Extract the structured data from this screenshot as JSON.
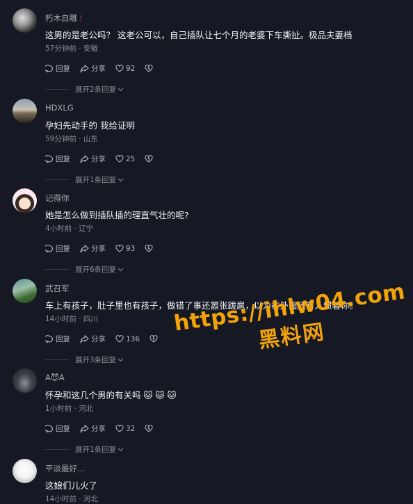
{
  "comments": [
    {
      "name": "朽木自雕",
      "name_suffix": "🕯",
      "text": "这男的是老公吗？ 这老公可以，自己插队让七个月的老婆下车撕扯。极品夫妻档",
      "meta": "57分钟前 · 安徽",
      "reply": "回复",
      "share": "分享",
      "likes": "92",
      "expand": "展开2条回复"
    },
    {
      "name": "HDXLG",
      "name_suffix": "",
      "text": "孕妇先动手的 我给证明",
      "meta": "59分钟前 · 山东",
      "reply": "回复",
      "share": "分享",
      "likes": "25",
      "expand": "展开1条回复"
    },
    {
      "name": "记得你",
      "name_suffix": "",
      "text": "她是怎么做到插队插的理直气壮的呢?",
      "meta": "4小时前 · 辽宁",
      "reply": "回复",
      "share": "分享",
      "likes": "93",
      "expand": "展开6条回复"
    },
    {
      "name": "武召军",
      "name_suffix": "",
      "text": "车上有孩子，肚子里也有孩子，做错了事还嚣张跋扈，以为在外面还有人惯着你。",
      "meta": "14小时前 · 四川",
      "reply": "回复",
      "share": "分享",
      "likes": "136",
      "expand": "展开3条回复"
    },
    {
      "name": "A😈A",
      "name_suffix": "",
      "text": "怀孕和这几个男的有关吗 🐱 🐱 🐱",
      "meta": "1小时前 · 河北",
      "reply": "回复",
      "share": "分享",
      "likes": "32",
      "expand": "展开1条回复"
    },
    {
      "name": "平淡最好…",
      "name_suffix": "",
      "text": "这娘们儿火了",
      "meta": "14小时前 · 河北",
      "reply": "",
      "share": "",
      "likes": "",
      "expand": ""
    }
  ],
  "watermark": {
    "line1": "https://ihlw04.com",
    "line2": "黑料网"
  },
  "colors": {
    "background": "#161823",
    "watermark": "#f0a30a"
  }
}
